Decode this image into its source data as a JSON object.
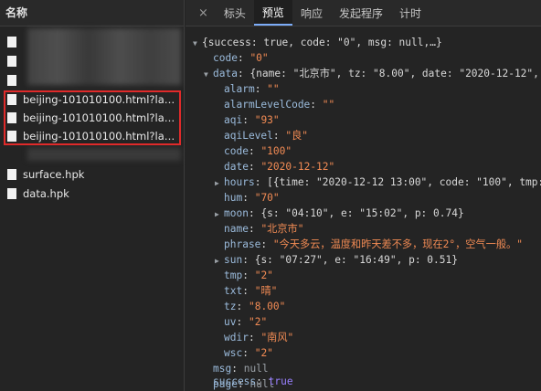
{
  "left": {
    "header": "名称",
    "files": [
      {
        "name": ""
      },
      {
        "name": ""
      },
      {
        "name": ""
      },
      {
        "name": "beijing-101010100.html?lang=..."
      },
      {
        "name": "beijing-101010100.html?lang=..."
      },
      {
        "name": "beijing-101010100.html?lang=..."
      },
      {
        "name": ""
      },
      {
        "name": "surface.hpk"
      },
      {
        "name": "data.hpk"
      }
    ]
  },
  "tabs": {
    "close": "×",
    "items": [
      "标头",
      "预览",
      "响应",
      "发起程序",
      "计时"
    ],
    "active": "预览"
  },
  "preview": {
    "root": "{success: true, code: \"0\", msg: null,…}",
    "code_key": "code",
    "code_val": "\"0\"",
    "data_key": "data",
    "data_summary": "{name: \"北京市\", tz: \"8.00\", date: \"2020-12-12\",",
    "fields": [
      {
        "k": "alarm",
        "v": "\"\""
      },
      {
        "k": "alarmLevelCode",
        "v": "\"\""
      },
      {
        "k": "aqi",
        "v": "\"93\""
      },
      {
        "k": "aqiLevel",
        "v": "\"良\""
      },
      {
        "k": "code",
        "v": "\"100\""
      },
      {
        "k": "date",
        "v": "\"2020-12-12\""
      }
    ],
    "hours_key": "hours",
    "hours_val": "[{time: \"2020-12-12 13:00\", code: \"100\", tmp:",
    "hum_key": "hum",
    "hum_val": "\"70\"",
    "moon_key": "moon",
    "moon_val": "{s: \"04:10\", e: \"15:02\", p: 0.74}",
    "name_key": "name",
    "name_val": "\"北京市\"",
    "phrase_key": "phrase",
    "phrase_val": "\"今天多云，温度和昨天差不多，现在2°，空气一般。\"",
    "sun_key": "sun",
    "sun_val": "{s: \"07:27\", e: \"16:49\", p: 0.51}",
    "fields2": [
      {
        "k": "tmp",
        "v": "\"2\""
      },
      {
        "k": "txt",
        "v": "\"晴\""
      },
      {
        "k": "tz",
        "v": "\"8.00\""
      },
      {
        "k": "uv",
        "v": "\"2\""
      },
      {
        "k": "wdir",
        "v": "\"南风\""
      },
      {
        "k": "wsc",
        "v": "\"2\""
      }
    ],
    "msg_key": "msg",
    "msg_val": "null",
    "page_key": "page",
    "page_val": "null",
    "success_key": "success",
    "success_val": "true"
  },
  "colors": {
    "highlight": "#e02a2a",
    "tab_active_underline": "#7cacf8",
    "json_key": "#9bbbdc",
    "json_string": "#f28b54",
    "json_literal": "#9980ff"
  }
}
